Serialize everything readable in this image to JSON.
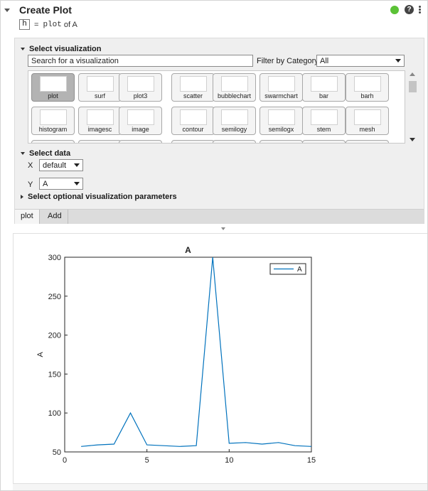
{
  "header": {
    "title": "Create Plot",
    "status_color": "#5bc236",
    "help_glyph": "?",
    "icons": [
      "collapse-arrow-icon",
      "status-indicator-icon",
      "help-icon",
      "more-options-icon"
    ]
  },
  "code": {
    "variable": "h",
    "equals": "=",
    "function": "plot",
    "of": "of A"
  },
  "select_visualization": {
    "label": "Select visualization",
    "search_placeholder": "Search for a visualization",
    "filter_label": "Filter by Category",
    "filter_value": "All",
    "tiles": [
      {
        "label": "plot",
        "selected": true
      },
      {
        "label": "surf"
      },
      {
        "label": "plot3"
      },
      {
        "label": "scatter"
      },
      {
        "label": "bubblechart"
      },
      {
        "label": "swarmchart"
      },
      {
        "label": "bar"
      },
      {
        "label": "barh"
      },
      {
        "label": "histogram"
      },
      {
        "label": "imagesc"
      },
      {
        "label": "image"
      },
      {
        "label": "contour"
      },
      {
        "label": "semilogy"
      },
      {
        "label": "semilogx"
      },
      {
        "label": "stem"
      },
      {
        "label": "mesh"
      }
    ]
  },
  "select_data": {
    "label": "Select data",
    "x_label": "X",
    "x_value": "default",
    "y_label": "Y",
    "y_value": "A"
  },
  "optional_params": {
    "label": "Select optional visualization parameters"
  },
  "tabs": [
    {
      "label": "plot",
      "active": true
    },
    {
      "label": "Add"
    }
  ],
  "chart_data": {
    "type": "line",
    "title": "A",
    "xlabel": "",
    "ylabel": "A",
    "xlim": [
      0,
      15
    ],
    "ylim": [
      50,
      300
    ],
    "xticks": [
      "0",
      "5",
      "10",
      "15"
    ],
    "yticks": [
      "50",
      "100",
      "150",
      "200",
      "250",
      "300"
    ],
    "legend_position": "top-right",
    "color": "#0072bd",
    "series": [
      {
        "name": "A",
        "x": [
          1,
          2,
          3,
          4,
          5,
          6,
          7,
          8,
          9,
          10,
          11,
          12,
          13,
          14,
          15
        ],
        "values": [
          57,
          59,
          60,
          100,
          59,
          58,
          57,
          58,
          300,
          61,
          62,
          60,
          62,
          58,
          57
        ]
      }
    ]
  }
}
